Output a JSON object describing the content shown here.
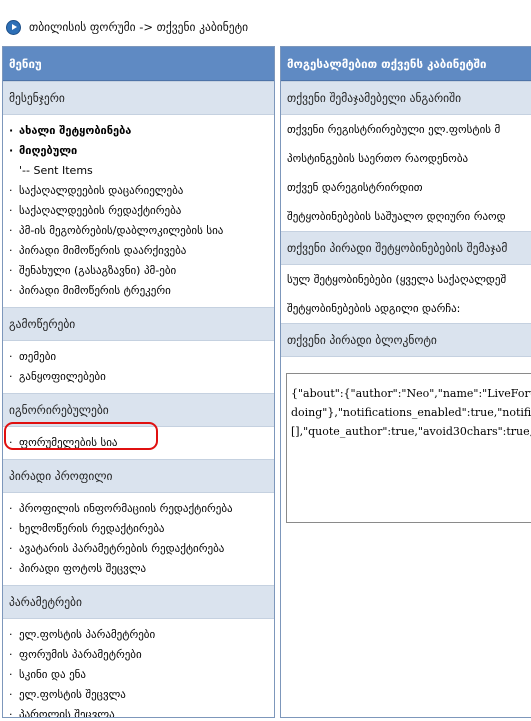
{
  "breadcrumb": {
    "text": "თბილისის ფორუმი -> თქვენი კაბინეტი"
  },
  "menu": {
    "title": "მენიუ",
    "sections": [
      {
        "title": "მესენჯერი",
        "items": [
          {
            "label": "ახალი შეტყობინება"
          },
          {
            "label": "მიღებული"
          },
          {
            "label": "'-- Sent Items"
          },
          {
            "label": "საქაღალდეების დაცარიელება"
          },
          {
            "label": "საქაღალდეების რედაქტირება"
          },
          {
            "label": "პმ-ის მეგობრების/დაბლოკილების სია"
          },
          {
            "label": "პირადი მიმოწერის დაარქივება"
          },
          {
            "label": "შენახული (გასაგზავნი) პმ-ები"
          },
          {
            "label": "პირადი მიმოწერის ტრეკერი"
          }
        ]
      },
      {
        "title": "გამოწერები",
        "items": [
          {
            "label": "თემები"
          },
          {
            "label": "განყოფილებები"
          }
        ]
      },
      {
        "title": "იგნორირებულები",
        "items": [
          {
            "label": "ფორუმელების სია"
          }
        ]
      },
      {
        "title": "პირადი პროფილი",
        "items": [
          {
            "label": "პროფილის ინფორმაციის რედაქტირება"
          },
          {
            "label": "ხელმოწერის რედაქტირება"
          },
          {
            "label": "ავატარის პარამეტრების რედაქტირება"
          },
          {
            "label": "პირადი ფოტოს შეცვლა"
          }
        ]
      },
      {
        "title": "პარამეტრები",
        "items": [
          {
            "label": "ელ.ფოსტის პარამეტრები"
          },
          {
            "label": "ფორუმის პარამეტრები"
          },
          {
            "label": "სკინი და ენა"
          },
          {
            "label": "ელ.ფოსტის შეცვლა"
          },
          {
            "label": "პაროლის შეცვლა"
          }
        ]
      }
    ]
  },
  "cabinet": {
    "title": "მოგესალმებით თქვენს კაბინეტში",
    "account_header": "თქვენი შემაჯამებელი ანგარიში",
    "email_row": "თქვენი რეგისტრირებული ელ.ფოსტის მ",
    "posts_row": "პოსტინგების საერთო რაოდენობა",
    "registered_row": "თქვენ დარეგისტრირდით",
    "avg_row": "შეტყობინებების საშუალო დღიური რაოდ",
    "pm_header": "თქვენი პირადი შეტყობინებების შემაჯამ",
    "all_msgs_row": "სულ შეტყობინებები (ყველა საქაღალდეშ",
    "space_row": "შეტყობინებების ადგილი დარჩა:",
    "notepad_header": "თქვენი პირადი ბლოკნოტი",
    "notepad_text": "{\"about\":{\"author\":\"Neo\",\"name\":\"LiveForum\ndoing\"},\"notifications_enabled\":true,\"notific\n[],\"quote_author\":true,\"avoid30chars\":true,\""
  },
  "accent": "#5f8ac3",
  "highlight": "#e01010"
}
